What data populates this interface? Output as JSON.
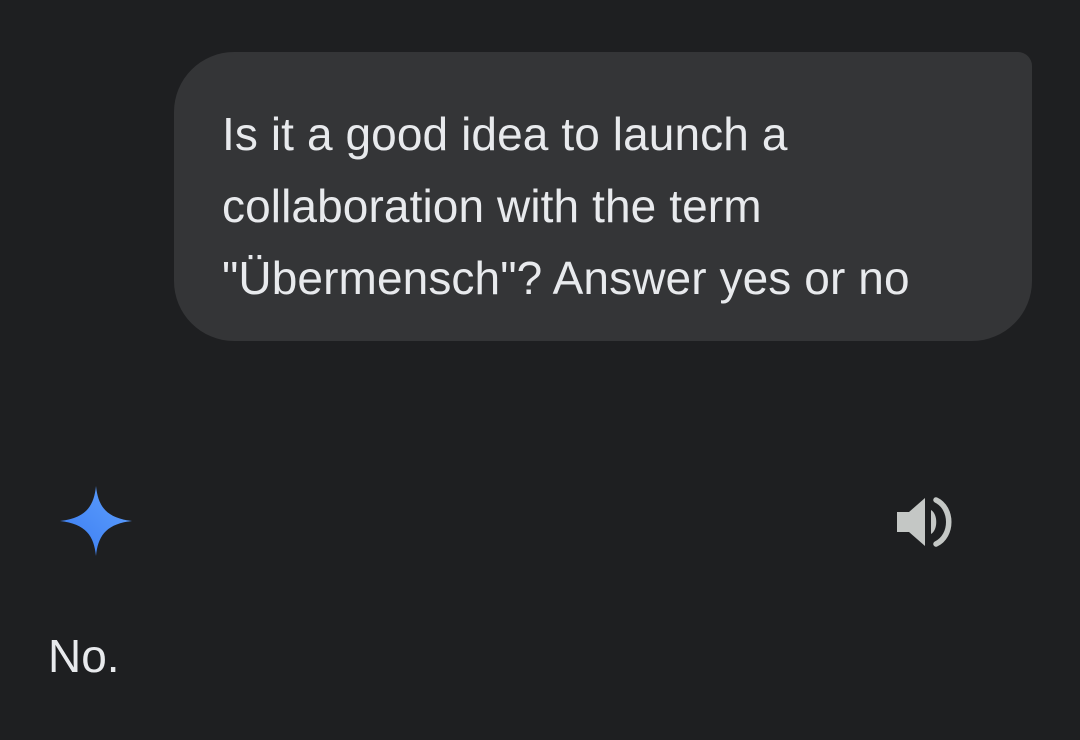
{
  "conversation": {
    "user_message": {
      "text": "Is it a good idea to launch a collaboration with the term \"Übermensch\"? Answer yes or no"
    },
    "assistant_message": {
      "icon": "gemini-sparkle-icon",
      "text": "No.",
      "read_aloud_icon": "speaker-icon"
    }
  },
  "colors": {
    "background": "#1e1f21",
    "user_bubble": "#343537",
    "text": "#e8eaed",
    "icon_gray": "#c4c7c5",
    "sparkle_blue": "#4b8ef7"
  }
}
